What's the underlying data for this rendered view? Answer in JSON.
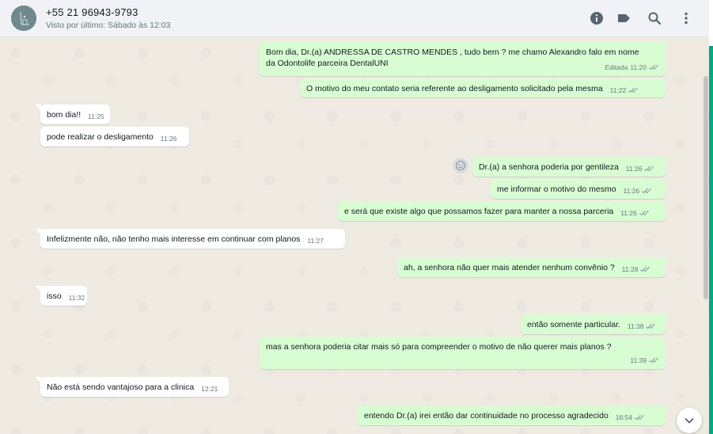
{
  "header": {
    "contact_name": "+55 21 96943-9793",
    "last_seen": "Visto por último: Sábado às 12:03",
    "icons": [
      "info-icon",
      "label-icon",
      "search-icon",
      "menu-icon"
    ]
  },
  "messages": [
    {
      "dir": "out",
      "lines": [
        "Bom dia, Dr.(a) ANDRESSA DE CASTRO MENDES , tudo bem ? me chamo Alexandro  falo em nome",
        "da Odontolife parceira DentalUNI"
      ],
      "edited": "Editada",
      "time": "11:20"
    },
    {
      "dir": "out",
      "lines": [
        "O motivo do meu contato seria referente ao desligamento solicitado pela mesma"
      ],
      "time": "11:22"
    },
    {
      "dir": "in",
      "lines": [
        "bom dia!!"
      ],
      "time": "11:25"
    },
    {
      "dir": "in",
      "lines": [
        "pode realizar o desligamento"
      ],
      "time": "11:26"
    },
    {
      "dir": "out",
      "lines": [
        "Dr.(a) a senhora poderia por gentileza"
      ],
      "time": "11:26"
    },
    {
      "dir": "out",
      "lines": [
        "me informar o motivo do mesmo"
      ],
      "time": "11:26"
    },
    {
      "dir": "out",
      "lines": [
        "e será que existe algo que possamos fazer para manter a nossa parceria"
      ],
      "time": "11:26"
    },
    {
      "dir": "in",
      "lines": [
        "Infelizmente não, não tenho mais interesse em continuar com planos"
      ],
      "time": "11:27"
    },
    {
      "dir": "out",
      "lines": [
        "ah, a senhora não quer mais atender nenhum convênio ?"
      ],
      "time": "11:28"
    },
    {
      "dir": "in",
      "lines": [
        "isso"
      ],
      "time": "11:32"
    },
    {
      "dir": "out",
      "lines": [
        "então somente particular."
      ],
      "time": "11:38"
    },
    {
      "dir": "out",
      "lines": [
        "mas a senhora poderia citar mais só para compreender o motivo de não querer mais planos ?"
      ],
      "time": "11:39"
    },
    {
      "dir": "in",
      "lines": [
        "Não está sendo vantajoso para a clinica"
      ],
      "time": "12:21"
    },
    {
      "dir": "out",
      "lines": [
        "entendo Dr.(a) irei então dar continuidade no processo agradecido"
      ],
      "time": "16:54"
    }
  ],
  "colors": {
    "outgoing_bubble": "#d9fdd3",
    "incoming_bubble": "#ffffff",
    "accent": "#00a884",
    "read_ticks": "#53bdeb"
  }
}
